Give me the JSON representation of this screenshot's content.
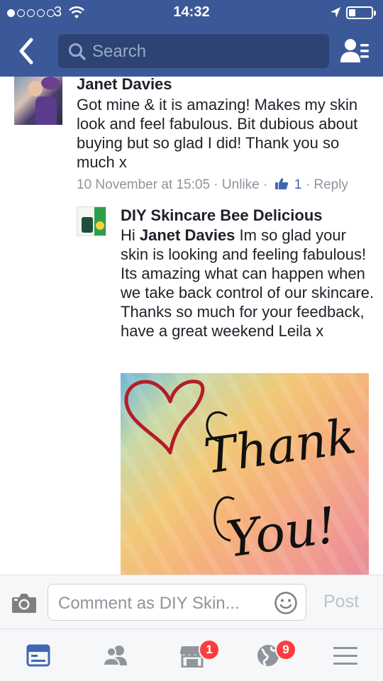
{
  "status_bar": {
    "carrier": "3",
    "time": "14:32",
    "signal_bars_filled": 1,
    "signal_bars_total": 5
  },
  "header": {
    "search_placeholder": "Search",
    "colors": {
      "brand": "#3b5998",
      "search_bg": "#2d4373"
    }
  },
  "comments": [
    {
      "author": "Janet Davies",
      "text": "Got mine & it is amazing! Makes my skin look and feel fabulous. Bit dubious about buying but so glad I did!  Thank you so much x",
      "timestamp": "10 November at 15:05",
      "unlike_label": "Unlike",
      "like_count": "1",
      "reply_label": "Reply",
      "separator": "·"
    },
    {
      "author": "DIY Skincare Bee Delicious",
      "text_prefix": "Hi ",
      "mention": "Janet Davies",
      "text_rest": " Im so glad your skin is looking and feeling fabulous! Its amazing what can happen when we take back control of our skincare. Thanks so much for your feedback, have a great weekend Leila x",
      "image_text_line1": "Thank",
      "image_text_line2": "You!"
    }
  ],
  "comment_bar": {
    "placeholder": "Comment as DIY Skin...",
    "post_label": "Post"
  },
  "tabs": [
    {
      "name": "news-feed",
      "icon": "news-feed-icon",
      "badge": ""
    },
    {
      "name": "friend-requests",
      "icon": "friends-icon",
      "badge": ""
    },
    {
      "name": "marketplace",
      "icon": "shop-icon",
      "badge": "1"
    },
    {
      "name": "notifications",
      "icon": "globe-icon",
      "badge": "9"
    },
    {
      "name": "more",
      "icon": "menu-icon",
      "badge": ""
    }
  ],
  "colors": {
    "accent": "#4267b2",
    "meta_text": "#90949c",
    "badge": "#fa3e3e"
  }
}
